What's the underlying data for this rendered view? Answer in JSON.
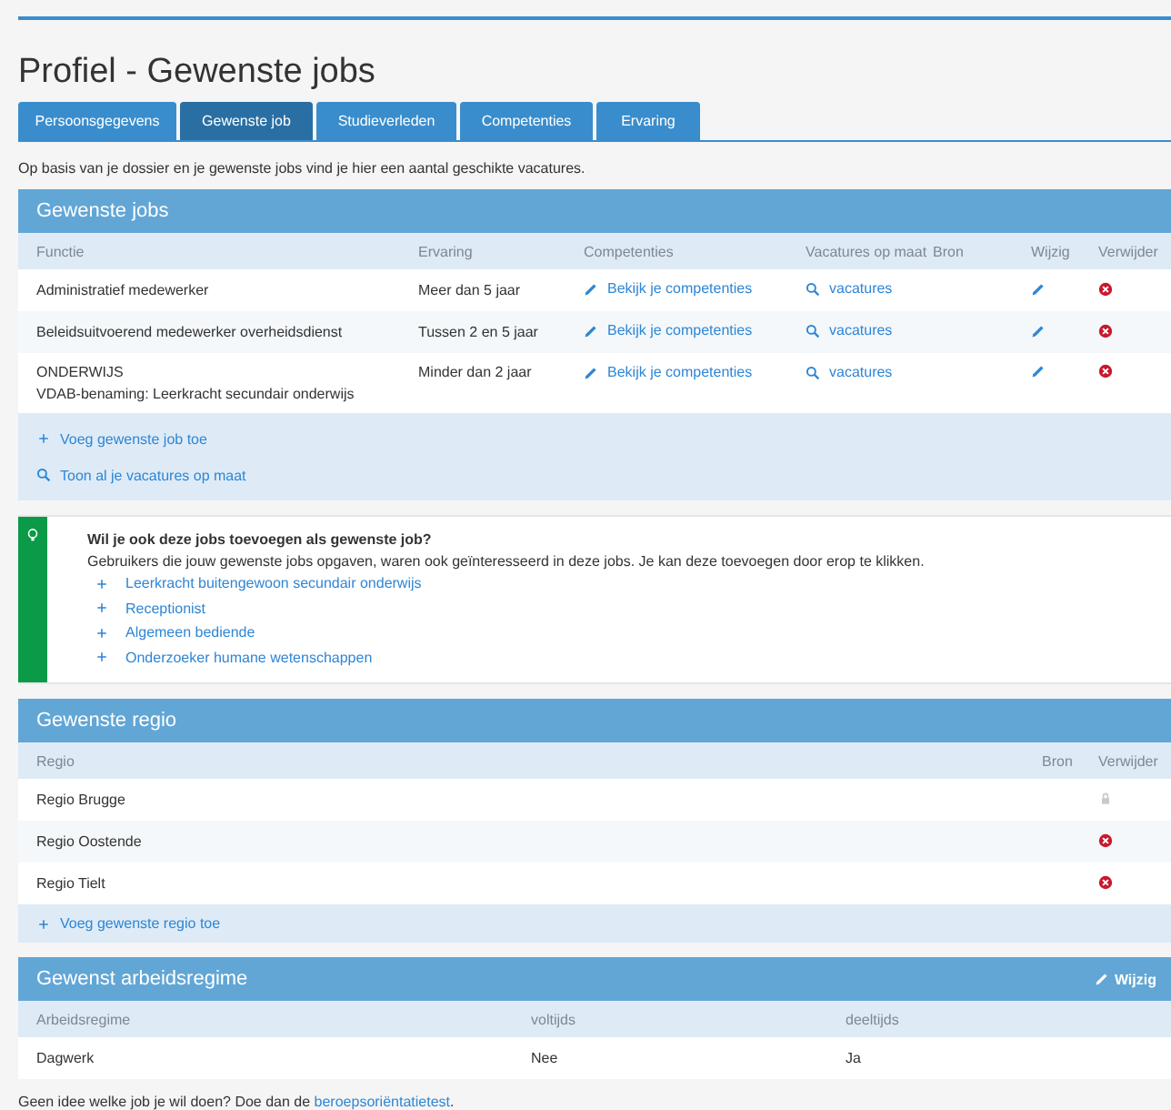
{
  "title": "Profiel - Gewenste jobs",
  "tabs": [
    {
      "label": "Persoonsgegevens",
      "selected": false
    },
    {
      "label": "Gewenste job",
      "selected": true
    },
    {
      "label": "Studieverleden",
      "selected": false
    },
    {
      "label": "Competenties",
      "selected": false
    },
    {
      "label": "Ervaring",
      "selected": false
    }
  ],
  "intro": "Op basis van je dossier en je gewenste jobs vind je hier een aantal geschikte vacatures.",
  "jobs": {
    "title": "Gewenste jobs",
    "columns": [
      "Functie",
      "Ervaring",
      "Competenties",
      "Vacatures op maat",
      "Bron",
      "Wijzig",
      "Verwijder"
    ],
    "rows": [
      {
        "function": "Administratief medewerker",
        "subtitle": "",
        "experience": "Meer dan 5 jaar",
        "competences": "Bekijk je competenties",
        "vacancies": "vacatures"
      },
      {
        "function": "Beleidsuitvoerend medewerker overheidsdienst",
        "subtitle": "",
        "experience": "Tussen 2 en 5 jaar",
        "competences": "Bekijk je competenties",
        "vacancies": "vacatures"
      },
      {
        "function": "ONDERWIJS",
        "subtitle": "VDAB-benaming: Leerkracht secundair onderwijs",
        "experience": "Minder dan 2 jaar",
        "competences": "Bekijk je competenties",
        "vacancies": "vacatures"
      }
    ],
    "actions": [
      {
        "kind": "add",
        "label": "Voeg gewenste job toe"
      },
      {
        "kind": "search",
        "label": "Toon al je vacatures op maat"
      }
    ]
  },
  "suggestions": {
    "title": "Wil je ook deze jobs toevoegen als gewenste job?",
    "text": "Gebruikers die jouw gewenste jobs opgaven, waren ook geïnteresseerd in deze jobs. Je kan deze toevoegen door erop te klikken.",
    "items": [
      "Leerkracht buitengewoon secundair onderwijs",
      "Receptionist",
      "Algemeen bediende",
      "Onderzoeker humane wetenschappen"
    ]
  },
  "regions": {
    "title": "Gewenste regio",
    "columns": [
      "Regio",
      "Bron",
      "Verwijder"
    ],
    "rows": [
      {
        "name": "Regio Brugge",
        "locked": true
      },
      {
        "name": "Regio Oostende",
        "locked": false
      },
      {
        "name": "Regio Tielt",
        "locked": false
      }
    ],
    "add": "Voeg gewenste regio toe"
  },
  "regime": {
    "title": "Gewenst arbeidsregime",
    "edit": "Wijzig",
    "columns": [
      "Arbeidsregime",
      "voltijds",
      "deeltijds"
    ],
    "rows": [
      [
        "Dagwerk",
        "Nee",
        "Ja"
      ]
    ]
  },
  "footer": {
    "text": "Geen idee welke job je wil doen? Doe dan de ",
    "link": "beroepsoriëntatietest",
    "end": "."
  }
}
